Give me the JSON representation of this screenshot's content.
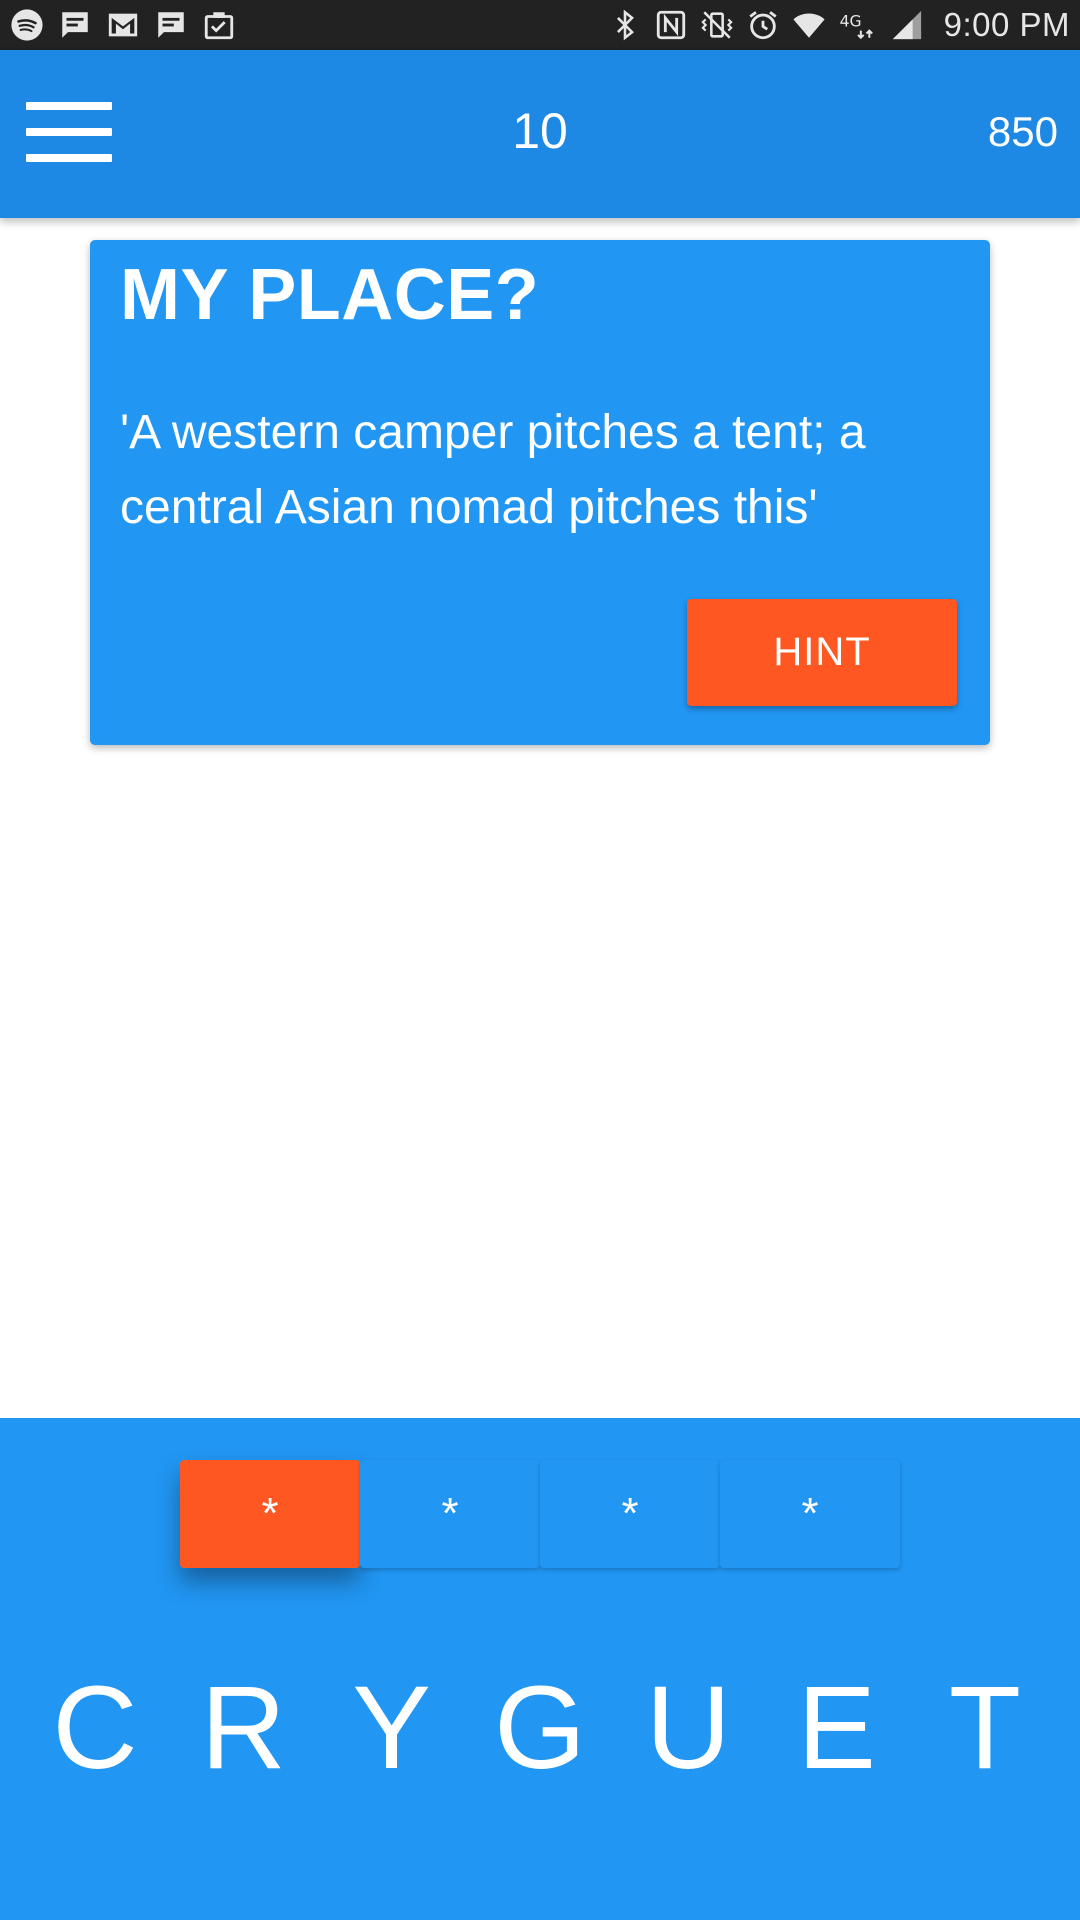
{
  "status_bar": {
    "time": "9:00 PM",
    "left_icons": [
      "spotify-icon",
      "message-icon",
      "gmail-icon",
      "message-icon",
      "clipboard-check-icon"
    ],
    "right_icons": [
      "bluetooth-icon",
      "nfc-icon",
      "vibrate-icon",
      "alarm-icon",
      "wifi-icon",
      "lte-icon",
      "signal-icon"
    ],
    "lte_label": "4G"
  },
  "app_bar": {
    "level": "10",
    "score": "850"
  },
  "card": {
    "title": "MY PLACE?",
    "clue": "'A western camper pitches a tent; a central Asian nomad pitches this'",
    "hint_label": "HINT"
  },
  "answer": {
    "slots": [
      "*",
      "*",
      "*",
      "*"
    ],
    "active_slot": 0
  },
  "letters": [
    "C",
    "R",
    "Y",
    "G",
    "U",
    "E",
    "T"
  ],
  "colors": {
    "status_bar": "#222222",
    "app_bar": "#1e88e5",
    "card": "#2196f3",
    "accent": "#ff5722",
    "bottom_panel": "#2196f3"
  }
}
